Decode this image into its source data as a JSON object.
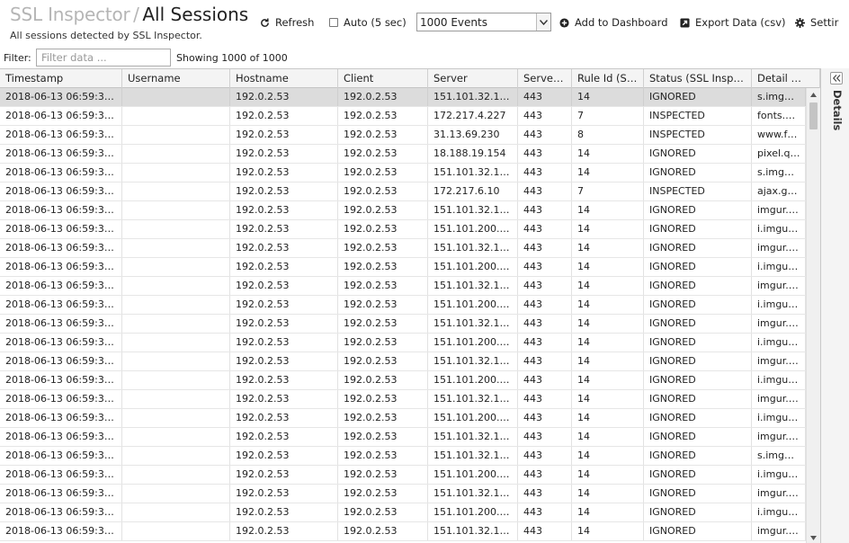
{
  "header": {
    "app_title": "SSL Inspector",
    "separator": "/",
    "page_title": "All Sessions",
    "subtitle": "All sessions detected by SSL Inspector."
  },
  "toolbar": {
    "refresh_label": "Refresh",
    "auto_label": "Auto (5 sec)",
    "auto_checked": false,
    "events_selected": "1000 Events",
    "add_dashboard_label": "Add to Dashboard",
    "export_label": "Export Data (csv)",
    "settings_label": "Settir"
  },
  "filter": {
    "label": "Filter:",
    "placeholder": "Filter data ...",
    "value": "",
    "showing": "Showing 1000 of 1000"
  },
  "table": {
    "columns": [
      "Timestamp",
      "Username",
      "Hostname",
      "Client",
      "Server",
      "Serve…",
      "Rule Id (S…",
      "Status (SSL Insp…",
      "Detail …"
    ],
    "selected_row": 0,
    "rows": [
      [
        "2018-06-13 06:59:3…",
        "",
        "192.0.2.53",
        "192.0.2.53",
        "151.101.32.1…",
        "443",
        "14",
        "IGNORED",
        "s.img…"
      ],
      [
        "2018-06-13 06:59:3…",
        "",
        "192.0.2.53",
        "192.0.2.53",
        "172.217.4.227",
        "443",
        "7",
        "INSPECTED",
        "fonts.…"
      ],
      [
        "2018-06-13 06:59:3…",
        "",
        "192.0.2.53",
        "192.0.2.53",
        "31.13.69.230",
        "443",
        "8",
        "INSPECTED",
        "www.f…"
      ],
      [
        "2018-06-13 06:59:3…",
        "",
        "192.0.2.53",
        "192.0.2.53",
        "18.188.19.154",
        "443",
        "14",
        "IGNORED",
        "pixel.q…"
      ],
      [
        "2018-06-13 06:59:3…",
        "",
        "192.0.2.53",
        "192.0.2.53",
        "151.101.32.1…",
        "443",
        "14",
        "IGNORED",
        "s.img…"
      ],
      [
        "2018-06-13 06:59:3…",
        "",
        "192.0.2.53",
        "192.0.2.53",
        "172.217.6.10",
        "443",
        "7",
        "INSPECTED",
        "ajax.g…"
      ],
      [
        "2018-06-13 06:59:3…",
        "",
        "192.0.2.53",
        "192.0.2.53",
        "151.101.32.1…",
        "443",
        "14",
        "IGNORED",
        "imgur.…"
      ],
      [
        "2018-06-13 06:59:3…",
        "",
        "192.0.2.53",
        "192.0.2.53",
        "151.101.200.…",
        "443",
        "14",
        "IGNORED",
        "i.imgu…"
      ],
      [
        "2018-06-13 06:59:3…",
        "",
        "192.0.2.53",
        "192.0.2.53",
        "151.101.32.1…",
        "443",
        "14",
        "IGNORED",
        "imgur.…"
      ],
      [
        "2018-06-13 06:59:3…",
        "",
        "192.0.2.53",
        "192.0.2.53",
        "151.101.200.…",
        "443",
        "14",
        "IGNORED",
        "i.imgu…"
      ],
      [
        "2018-06-13 06:59:3…",
        "",
        "192.0.2.53",
        "192.0.2.53",
        "151.101.32.1…",
        "443",
        "14",
        "IGNORED",
        "imgur.…"
      ],
      [
        "2018-06-13 06:59:3…",
        "",
        "192.0.2.53",
        "192.0.2.53",
        "151.101.200.…",
        "443",
        "14",
        "IGNORED",
        "i.imgu…"
      ],
      [
        "2018-06-13 06:59:3…",
        "",
        "192.0.2.53",
        "192.0.2.53",
        "151.101.32.1…",
        "443",
        "14",
        "IGNORED",
        "imgur.…"
      ],
      [
        "2018-06-13 06:59:3…",
        "",
        "192.0.2.53",
        "192.0.2.53",
        "151.101.200.…",
        "443",
        "14",
        "IGNORED",
        "i.imgu…"
      ],
      [
        "2018-06-13 06:59:3…",
        "",
        "192.0.2.53",
        "192.0.2.53",
        "151.101.32.1…",
        "443",
        "14",
        "IGNORED",
        "imgur.…"
      ],
      [
        "2018-06-13 06:59:3…",
        "",
        "192.0.2.53",
        "192.0.2.53",
        "151.101.200.…",
        "443",
        "14",
        "IGNORED",
        "i.imgu…"
      ],
      [
        "2018-06-13 06:59:3…",
        "",
        "192.0.2.53",
        "192.0.2.53",
        "151.101.32.1…",
        "443",
        "14",
        "IGNORED",
        "imgur.…"
      ],
      [
        "2018-06-13 06:59:3…",
        "",
        "192.0.2.53",
        "192.0.2.53",
        "151.101.200.…",
        "443",
        "14",
        "IGNORED",
        "i.imgu…"
      ],
      [
        "2018-06-13 06:59:3…",
        "",
        "192.0.2.53",
        "192.0.2.53",
        "151.101.32.1…",
        "443",
        "14",
        "IGNORED",
        "imgur.…"
      ],
      [
        "2018-06-13 06:59:3…",
        "",
        "192.0.2.53",
        "192.0.2.53",
        "151.101.32.1…",
        "443",
        "14",
        "IGNORED",
        "s.img…"
      ],
      [
        "2018-06-13 06:59:3…",
        "",
        "192.0.2.53",
        "192.0.2.53",
        "151.101.200.…",
        "443",
        "14",
        "IGNORED",
        "i.imgu…"
      ],
      [
        "2018-06-13 06:59:3…",
        "",
        "192.0.2.53",
        "192.0.2.53",
        "151.101.32.1…",
        "443",
        "14",
        "IGNORED",
        "imgur.…"
      ],
      [
        "2018-06-13 06:59:3…",
        "",
        "192.0.2.53",
        "192.0.2.53",
        "151.101.200.…",
        "443",
        "14",
        "IGNORED",
        "i.imgu…"
      ],
      [
        "2018-06-13 06:59:3…",
        "",
        "192.0.2.53",
        "192.0.2.53",
        "151.101.32.1…",
        "443",
        "14",
        "IGNORED",
        "imgur.…"
      ]
    ]
  },
  "details_panel": {
    "label": "Details"
  },
  "icons": {
    "refresh": "refresh-icon",
    "add_dashboard": "plus-circle-icon",
    "export": "export-icon",
    "settings": "gear-icon",
    "dropdown": "chevron-down-icon",
    "collapse": "double-chevron-left-icon",
    "scroll_up": "scroll-up-icon",
    "scroll_down": "scroll-down-icon"
  }
}
